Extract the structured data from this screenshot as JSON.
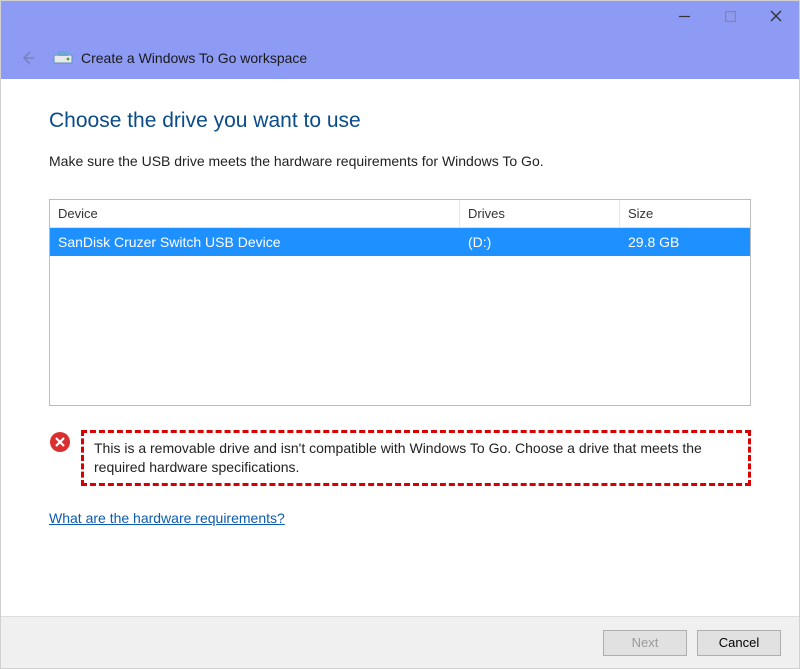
{
  "window": {
    "title": "Create a Windows To Go workspace"
  },
  "page": {
    "heading": "Choose the drive you want to use",
    "subheading": "Make sure the USB drive meets the hardware requirements for Windows To Go."
  },
  "table": {
    "headers": {
      "device": "Device",
      "drives": "Drives",
      "size": "Size"
    },
    "rows": [
      {
        "device": "SanDisk Cruzer Switch USB Device",
        "drives": "(D:)",
        "size": "29.8 GB"
      }
    ]
  },
  "warning": {
    "text": "This is a removable drive and isn't compatible with Windows To Go. Choose a drive that meets the required hardware specifications."
  },
  "link": {
    "hardware_requirements": "What are the hardware requirements?"
  },
  "buttons": {
    "next": "Next",
    "cancel": "Cancel"
  }
}
